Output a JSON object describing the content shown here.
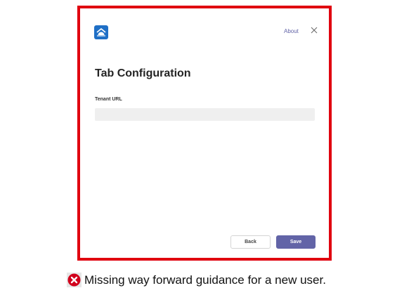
{
  "dialog": {
    "about_label": "About",
    "title": "Tab Configuration",
    "field_label": "Tenant URL",
    "field_value": "",
    "back_label": "Back",
    "save_label": "Save"
  },
  "caption": {
    "text": "Missing way forward guidance for a new user."
  },
  "colors": {
    "highlight_border": "#e0000f",
    "accent": "#6264a7",
    "app_logo": "#1f6fc6",
    "error_icon": "#d1001c"
  },
  "icons": {
    "app_logo": "app-logo-icon",
    "close": "close-icon",
    "error": "error-icon"
  }
}
